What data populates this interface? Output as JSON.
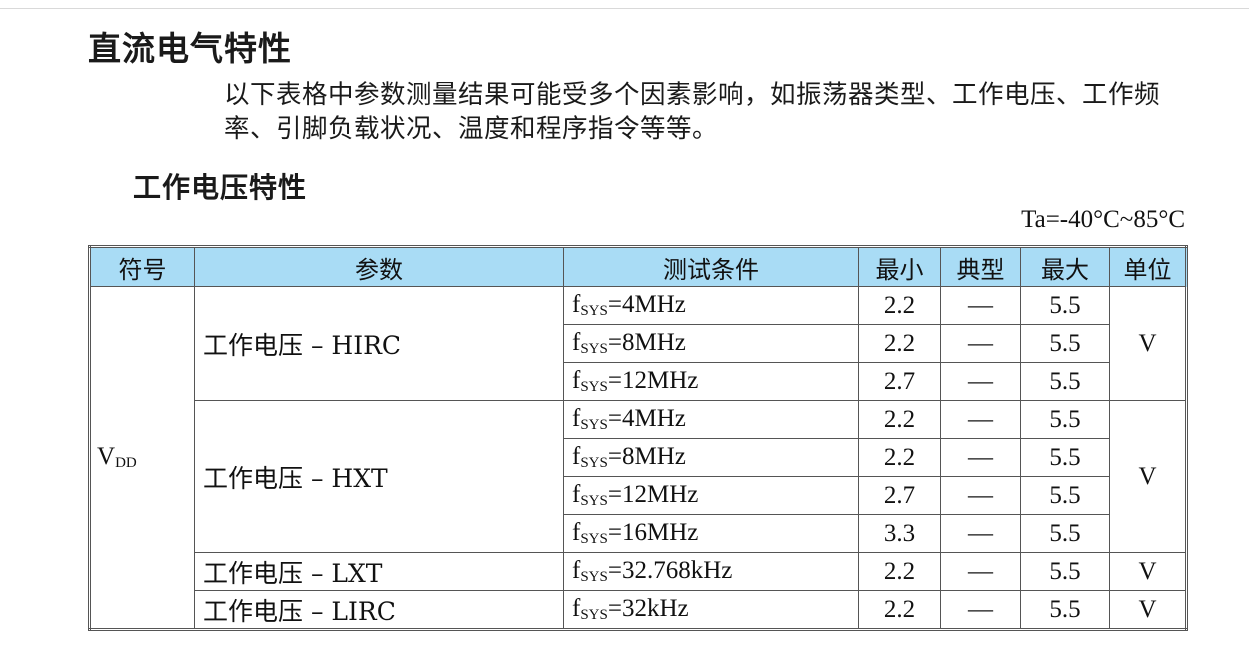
{
  "section": {
    "title": "直流电气特性",
    "intro": "以下表格中参数测量结果可能受多个因素影响，如振荡器类型、工作电压、工作频率、引脚负载状况、温度和程序指令等等。"
  },
  "subsection": {
    "title": "工作电压特性",
    "condition": "Ta=-40°C~85°C"
  },
  "table": {
    "headers": [
      "符号",
      "参数",
      "测试条件",
      "最小",
      "典型",
      "最大",
      "单位"
    ],
    "symbol_main": "V",
    "symbol_sub": "DD",
    "cond_prefix": "f",
    "cond_sub": "SYS",
    "groups": [
      {
        "param": "工作电压 – HIRC",
        "unit": "V",
        "rows": [
          {
            "cond": "=4MHz",
            "min": "2.2",
            "typ": "—",
            "max": "5.5"
          },
          {
            "cond": "=8MHz",
            "min": "2.2",
            "typ": "—",
            "max": "5.5"
          },
          {
            "cond": "=12MHz",
            "min": "2.7",
            "typ": "—",
            "max": "5.5"
          }
        ]
      },
      {
        "param": "工作电压 – HXT",
        "unit": "V",
        "rows": [
          {
            "cond": "=4MHz",
            "min": "2.2",
            "typ": "—",
            "max": "5.5"
          },
          {
            "cond": "=8MHz",
            "min": "2.2",
            "typ": "—",
            "max": "5.5"
          },
          {
            "cond": "=12MHz",
            "min": "2.7",
            "typ": "—",
            "max": "5.5"
          },
          {
            "cond": "=16MHz",
            "min": "3.3",
            "typ": "—",
            "max": "5.5"
          }
        ]
      },
      {
        "param": "工作电压 – LXT",
        "unit": "V",
        "rows": [
          {
            "cond": "=32.768kHz",
            "min": "2.2",
            "typ": "—",
            "max": "5.5"
          }
        ]
      },
      {
        "param": "工作电压 – LIRC",
        "unit": "V",
        "rows": [
          {
            "cond": "=32kHz",
            "min": "2.2",
            "typ": "—",
            "max": "5.5"
          }
        ]
      }
    ]
  }
}
